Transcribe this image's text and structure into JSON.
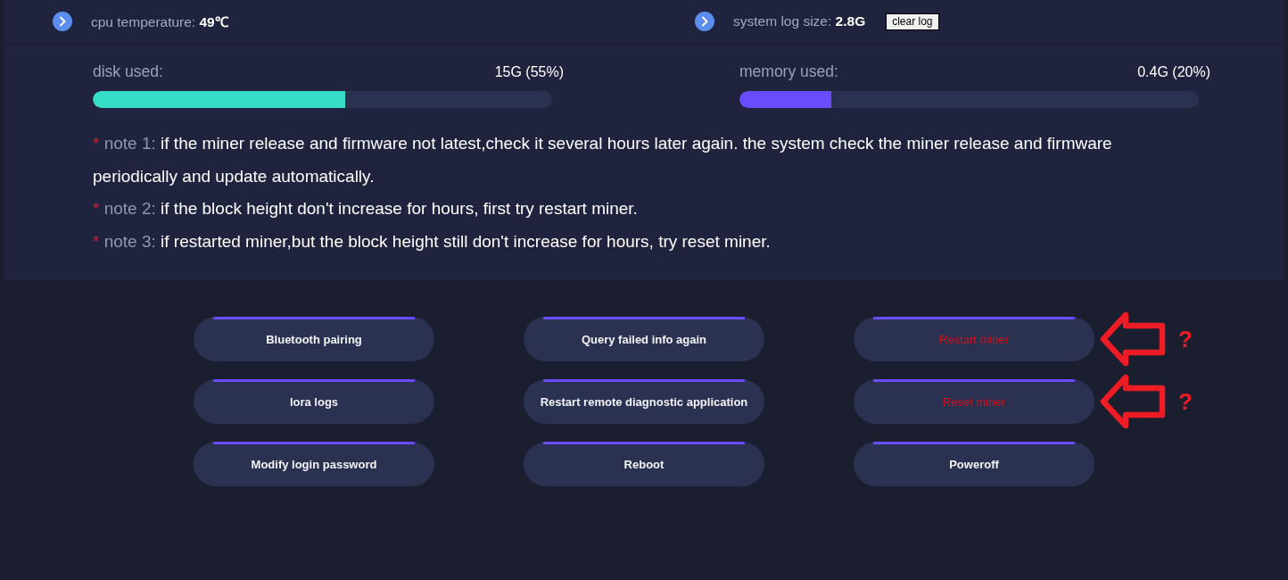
{
  "status_row": [
    {
      "label": "cpu temperature:",
      "value": "49℃"
    },
    {
      "label": "system log size:",
      "value": "2.8G",
      "action": "clear log"
    }
  ],
  "usage": [
    {
      "label": "disk used:",
      "reading": "15G (55%)",
      "level": 0.55,
      "color": "#35dcc6"
    },
    {
      "label": "memory used:",
      "reading": "0.4G (20%)",
      "level": 0.2,
      "color": "#6a4cff"
    }
  ],
  "notes": [
    {
      "marker": "*",
      "label": "note 1:",
      "text": "if the miner release and firmware not latest,check it several hours later again. the system check the miner release and firmware periodically and update automatically."
    },
    {
      "marker": "*",
      "label": "note 2:",
      "text": "if the block height don't increase for hours, first try restart miner."
    },
    {
      "marker": "*",
      "label": "note 3:",
      "text": "if restarted miner,but the block height still don't increase for hours, try reset miner."
    }
  ],
  "buttons": [
    {
      "label": "Bluetooth pairing",
      "kind": "normal"
    },
    {
      "label": "Query failed info again",
      "kind": "normal"
    },
    {
      "label": "Restart miner",
      "kind": "danger",
      "annotation": "?"
    },
    {
      "label": "lora logs",
      "kind": "normal"
    },
    {
      "label": "Restart remote diagnostic application",
      "kind": "normal"
    },
    {
      "label": "Reset miner",
      "kind": "danger",
      "annotation": "?"
    },
    {
      "label": "Modify login password",
      "kind": "normal"
    },
    {
      "label": "Reboot",
      "kind": "normal"
    },
    {
      "label": "Poweroff",
      "kind": "normal"
    }
  ]
}
